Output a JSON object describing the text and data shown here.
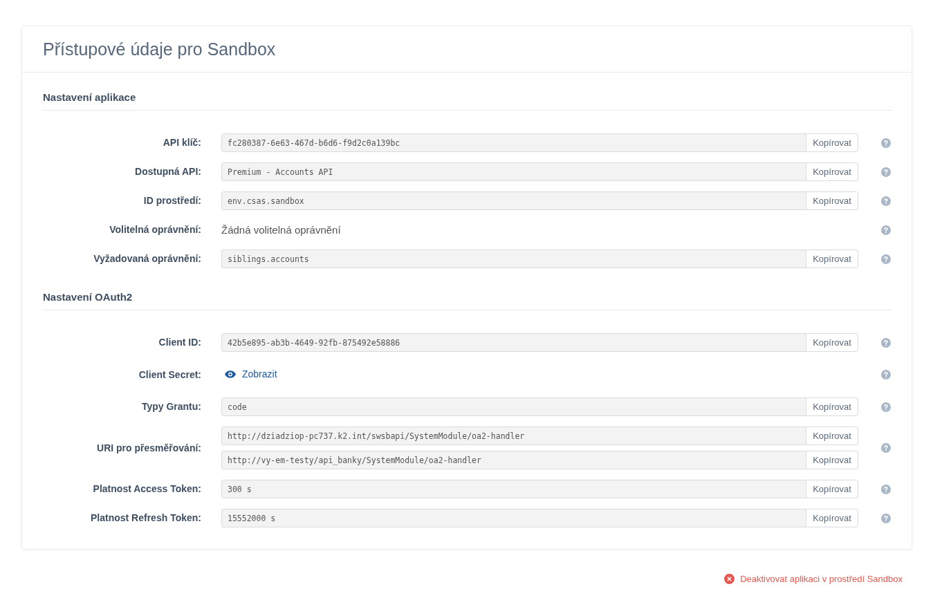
{
  "card": {
    "title": "Přístupové údaje pro Sandbox",
    "sections": [
      {
        "heading": "Nastavení aplikace",
        "rows": [
          {
            "kind": "copy",
            "label": "API klíč:",
            "fields": [
              {
                "value": "fc280387-6e63-467d-b6d6-f9d2c0a139bc",
                "button": "Kopírovat"
              }
            ]
          },
          {
            "kind": "copy",
            "label": "Dostupná API:",
            "fields": [
              {
                "value": "Premium - Accounts API",
                "button": "Kopírovat"
              }
            ]
          },
          {
            "kind": "copy",
            "label": "ID prostředí:",
            "fields": [
              {
                "value": "env.csas.sandbox",
                "button": "Kopírovat"
              }
            ]
          },
          {
            "kind": "text",
            "label": "Volitelná oprávnění:",
            "text": "Žádná volitelná oprávnění"
          },
          {
            "kind": "copy",
            "label": "Vyžadovaná oprávnění:",
            "fields": [
              {
                "value": "siblings.accounts",
                "button": "Kopírovat"
              }
            ]
          }
        ]
      },
      {
        "heading": "Nastavení OAuth2",
        "rows": [
          {
            "kind": "copy",
            "label": "Client ID:",
            "fields": [
              {
                "value": "42b5e895-ab3b-4649-92fb-875492e58886",
                "button": "Kopírovat"
              }
            ]
          },
          {
            "kind": "reveal",
            "label": "Client Secret:",
            "link": "Zobrazit"
          },
          {
            "kind": "copy",
            "label": "Typy Grantu:",
            "fields": [
              {
                "value": "code",
                "button": "Kopírovat"
              }
            ]
          },
          {
            "kind": "copy",
            "label": "URI pro přesměřování:",
            "fields": [
              {
                "value": "http://dziadziop-pc737.k2.int/swsbapi/SystemModule/oa2-handler",
                "button": "Kopírovat"
              },
              {
                "value": "http://vy-em-testy/api_banky/SystemModule/oa2-handler",
                "button": "Kopírovat"
              }
            ]
          },
          {
            "kind": "copy",
            "label": "Platnost Access Token:",
            "fields": [
              {
                "value": "300 s",
                "button": "Kopírovat"
              }
            ]
          },
          {
            "kind": "copy",
            "label": "Platnost Refresh Token:",
            "fields": [
              {
                "value": "15552000 s",
                "button": "Kopírovat"
              }
            ]
          }
        ]
      }
    ]
  },
  "deactivate_link": "Deaktivovat aplikaci v prostředí Sandbox"
}
